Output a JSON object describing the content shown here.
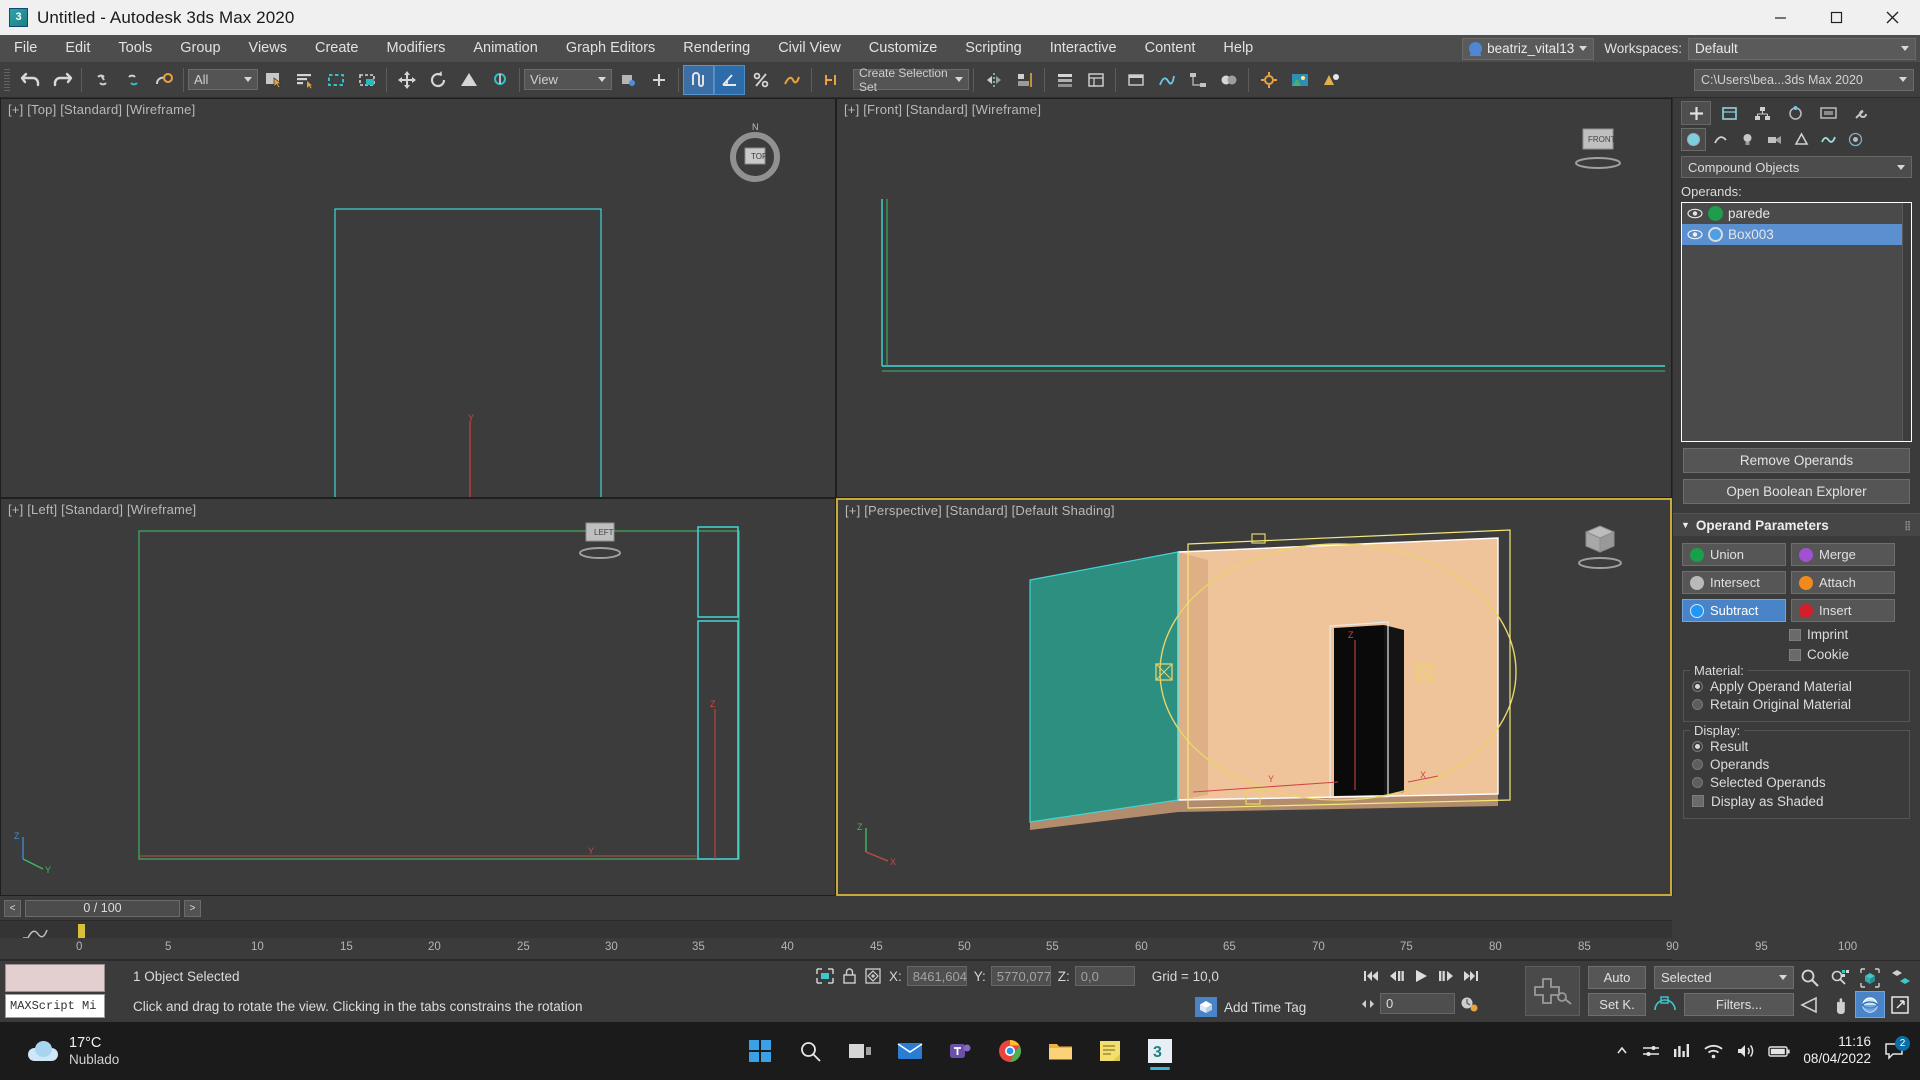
{
  "titlebar": {
    "title": "Untitled - Autodesk 3ds Max 2020",
    "app_icon": "3dsmax-icon",
    "minimize": "minimize-icon",
    "maximize": "maximize-icon",
    "close": "close-icon"
  },
  "menubar": {
    "items": [
      {
        "label": "File"
      },
      {
        "label": "Edit"
      },
      {
        "label": "Tools"
      },
      {
        "label": "Group"
      },
      {
        "label": "Views"
      },
      {
        "label": "Create"
      },
      {
        "label": "Modifiers"
      },
      {
        "label": "Animation"
      },
      {
        "label": "Graph Editors"
      },
      {
        "label": "Rendering"
      },
      {
        "label": "Civil View"
      },
      {
        "label": "Customize"
      },
      {
        "label": "Scripting"
      },
      {
        "label": "Interactive"
      },
      {
        "label": "Content"
      },
      {
        "label": "Help"
      }
    ],
    "user": "beatriz_vital13",
    "workspaces_label": "Workspaces:",
    "workspace_value": "Default"
  },
  "toolbar": {
    "selection_filter": "All",
    "reference_coord": "View",
    "named_selection_set": "Create Selection Set",
    "project_path": "C:\\Users\\bea...3ds Max 2020",
    "icons": [
      "undo-icon",
      "redo-icon",
      "select-and-link-icon",
      "unlink-selection-icon",
      "bind-to-space-warp-icon",
      "select-object-icon",
      "select-by-name-icon",
      "rectangular-selection-region-icon",
      "window-crossing-icon",
      "select-and-move-icon",
      "select-and-rotate-icon",
      "select-and-scale-icon",
      "select-and-place-icon",
      "use-center-flyout-icon",
      "select-and-manipulate-icon",
      "snaps-toggle-icon",
      "angle-snap-toggle-icon",
      "percent-snap-toggle-icon",
      "spinner-snap-toggle-icon",
      "edit-named-selection-icon",
      "mirror-icon",
      "align-icon",
      "layer-explorer-icon",
      "scene-explorer-icon",
      "toggle-ribbon-icon",
      "curve-editor-icon",
      "schematic-view-icon",
      "material-editor-icon",
      "render-setup-icon",
      "rendered-frame-window-icon",
      "render-production-icon"
    ]
  },
  "viewports": [
    {
      "name": "top",
      "label": "[+] [Top] [Standard] [Wireframe]",
      "active": false
    },
    {
      "name": "front",
      "label": "[+] [Front] [Standard] [Wireframe]",
      "active": false
    },
    {
      "name": "left",
      "label": "[+] [Left] [Standard] [Wireframe]",
      "active": false
    },
    {
      "name": "perspective",
      "label": "[+] [Perspective] [Standard] [Default Shading]",
      "active": true
    }
  ],
  "command_panel": {
    "tabs_row1": [
      "create-tab-icon",
      "modify-tab-icon",
      "hierarchy-tab-icon",
      "motion-tab-icon",
      "display-tab-icon",
      "utilities-tab-icon"
    ],
    "tabs_row2": [
      "geometry-icon",
      "shapes-icon",
      "lights-icon",
      "cameras-icon",
      "helpers-icon",
      "space-warps-icon",
      "systems-icon"
    ],
    "category": "Compound Objects",
    "operands_label": "Operands:",
    "operands": [
      {
        "name": "parede",
        "selected": false,
        "color": "#1f9d4e"
      },
      {
        "name": "Box003",
        "selected": true,
        "color": "#4f9fe0"
      }
    ],
    "remove_operands": "Remove Operands",
    "open_boolean_explorer": "Open Boolean Explorer",
    "operand_parameters_title": "Operand Parameters",
    "boolean_ops": [
      {
        "label": "Union",
        "color": "#17a04a",
        "active": false
      },
      {
        "label": "Merge",
        "color": "#a050d0",
        "active": false
      },
      {
        "label": "Intersect",
        "color": "#b9b9b9",
        "active": false
      },
      {
        "label": "Attach",
        "color": "#f08a1d",
        "active": false
      },
      {
        "label": "Subtract",
        "color": "#2196f3",
        "active": true
      },
      {
        "label": "Insert",
        "color": "#d41f2a",
        "active": false
      }
    ],
    "imprint": "Imprint",
    "cookie": "Cookie",
    "material_legend": "Material:",
    "material_options": [
      {
        "label": "Apply Operand Material",
        "selected": true
      },
      {
        "label": "Retain Original Material",
        "selected": false
      }
    ],
    "display_legend": "Display:",
    "display_options": [
      {
        "label": "Result",
        "selected": true
      },
      {
        "label": "Operands",
        "selected": false
      },
      {
        "label": "Selected Operands",
        "selected": false
      }
    ],
    "display_as_shaded": "Display as Shaded"
  },
  "timeline": {
    "prev_label": "<",
    "next_label": ">",
    "current_range": "0 / 100",
    "ruler_ticks": [
      "0",
      "5",
      "10",
      "15",
      "20",
      "25",
      "30",
      "35",
      "40",
      "45",
      "50",
      "55",
      "60",
      "65",
      "70",
      "75",
      "80",
      "85",
      "90",
      "95",
      "100"
    ]
  },
  "statusbar": {
    "maxscript_mini": "MAXScript Mi",
    "selection_status": "1 Object Selected",
    "prompt": "Click and drag to rotate the view.  Clicking in the tabs constrains the rotation",
    "coord_x_label": "X:",
    "coord_x_value": "8461,604",
    "coord_y_label": "Y:",
    "coord_y_value": "5770,077",
    "coord_z_label": "Z:",
    "coord_z_value": "0,0",
    "grid": "Grid = 10,0",
    "add_time_tag": "Add Time Tag",
    "auto_key": "Auto",
    "set_key": "Set K.",
    "key_filter": "Selected",
    "filters": "Filters...",
    "frame_value": "0",
    "nav_icons": [
      "zoom-icon",
      "zoom-all-icon",
      "zoom-extents-icon",
      "zoom-region-icon",
      "field-of-view-icon",
      "pan-icon",
      "orbit-icon",
      "maximize-viewport-icon"
    ]
  },
  "taskbar": {
    "weather_temp": "17°C",
    "weather_desc": "Nublado",
    "apps": [
      "start-icon",
      "search-icon",
      "task-view-icon",
      "mail-icon",
      "teams-icon",
      "chrome-icon",
      "file-explorer-icon",
      "sticky-notes-icon",
      "3dsmax-icon"
    ],
    "tray": [
      "show-hidden-icons-icon",
      "settings-sync-icon",
      "audio-mixer-icon",
      "wifi-icon",
      "volume-icon",
      "battery-icon"
    ],
    "time": "11:16",
    "date": "08/04/2022",
    "notification_count": "2"
  }
}
